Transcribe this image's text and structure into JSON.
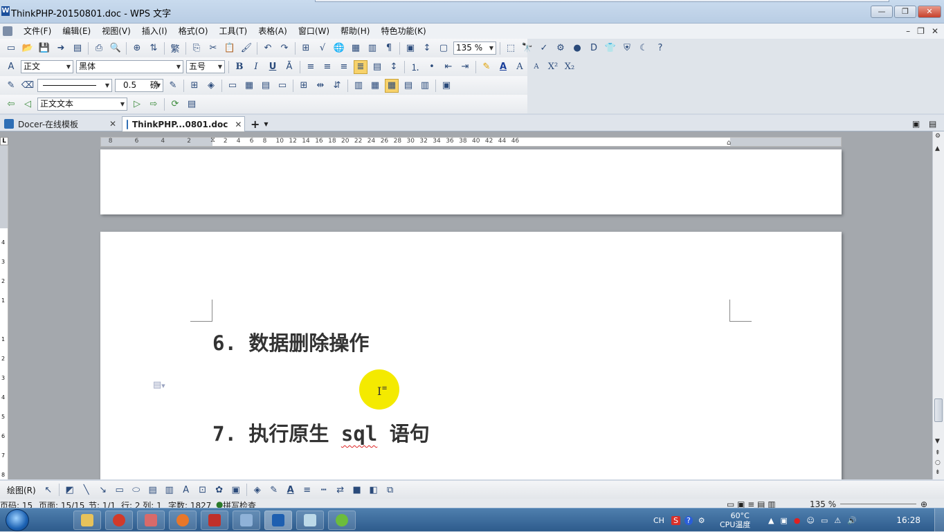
{
  "window": {
    "title": "ThinkPHP-20150801.doc - WPS 文字",
    "app_icon": "W",
    "minimize": "—",
    "restore": "❐",
    "close": "✕"
  },
  "menu": {
    "items": [
      "文件(F)",
      "编辑(E)",
      "视图(V)",
      "插入(I)",
      "格式(O)",
      "工具(T)",
      "表格(A)",
      "窗口(W)",
      "帮助(H)",
      "特色功能(K)"
    ],
    "mdi_min": "–",
    "mdi_restore": "❐",
    "mdi_close": "✕"
  },
  "toolbar_standard": {
    "zoom": "135 %"
  },
  "toolbar_format": {
    "style": "正文",
    "font": "黑体",
    "size": "五号",
    "bold": "B",
    "italic": "I",
    "underline": "U",
    "font_color": "A",
    "grow": "A",
    "shrink": "A",
    "superscript": "X²",
    "subscript": "X₂"
  },
  "toolbar_table": {
    "line_width": "0.5",
    "line_unit": "磅"
  },
  "toolbar_outline": {
    "outline_style": "正文文本"
  },
  "tabs": [
    {
      "label": "Docer-在线模板",
      "close": "✕"
    },
    {
      "label": "ThinkPHP...0801.doc",
      "close": "✕"
    }
  ],
  "tab_add": "+",
  "ruler": {
    "left_labels": [
      "8",
      "6",
      "4",
      "2"
    ],
    "right_labels": [
      "2",
      "4",
      "6",
      "8",
      "10",
      "12",
      "14",
      "16",
      "18",
      "20",
      "22",
      "24",
      "26",
      "28",
      "30",
      "32",
      "34",
      "36",
      "38",
      "40",
      "42",
      "44",
      "46"
    ],
    "vertical_top": [
      "4",
      "3",
      "2",
      "1"
    ],
    "vertical_bottom": [
      "1",
      "2",
      "3",
      "4",
      "5",
      "6",
      "7",
      "8"
    ],
    "corner": "L"
  },
  "document": {
    "heading6_num": "6.",
    "heading6_text": "数据删除操作",
    "heading7_num": "7.",
    "heading7_pre": "执行原生",
    "heading7_sql": "sql",
    "heading7_post": "语句"
  },
  "drawbar": {
    "label": "绘图(R)"
  },
  "status": {
    "page_no": "页码: 15",
    "pages": "页面: 15/15",
    "section": "节: 1/1",
    "position": "行: 2  列: 1",
    "word_count": "字数: 1827",
    "spell": "拼写检查",
    "zoom": "135 %"
  },
  "taskbar": {
    "lang": "CH",
    "temp": "60°C",
    "temp_label": "CPU温度",
    "clock": "16:28"
  }
}
